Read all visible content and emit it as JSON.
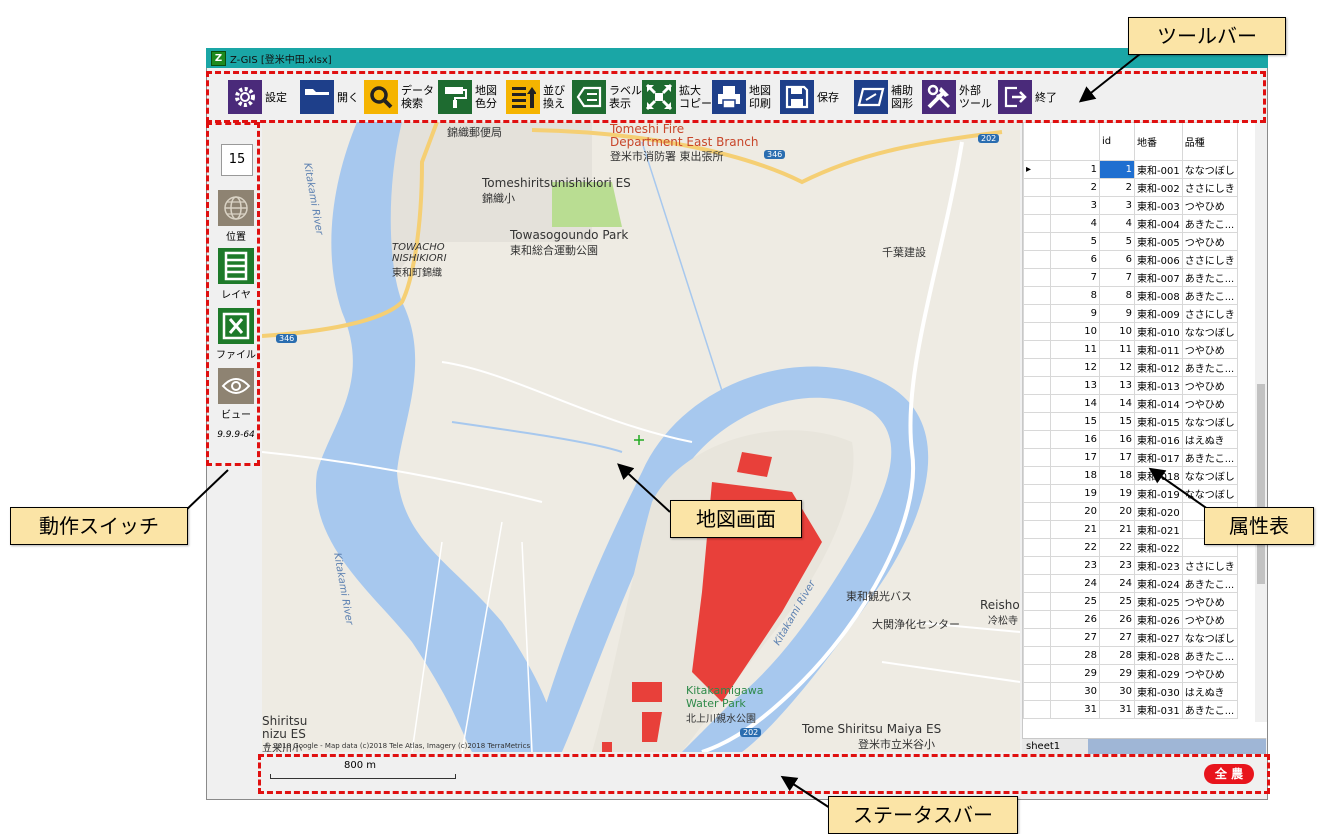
{
  "window": {
    "title": "Z-GIS [登米中田.xlsx]",
    "logo": "Z"
  },
  "toolbar": {
    "items": [
      {
        "label": "設定",
        "icon": "gear-icon",
        "bg": "#4a2a7a"
      },
      {
        "label": "開く",
        "icon": "folder-icon",
        "bg": "#1e3f8a"
      },
      {
        "label": "データ\n検索",
        "icon": "search-icon",
        "bg": "#f5b400"
      },
      {
        "label": "地図\n色分",
        "icon": "paint-roller-icon",
        "bg": "#1e6b30"
      },
      {
        "label": "並び\n換え",
        "icon": "sort-icon",
        "bg": "#f5b400"
      },
      {
        "label": "ラベル\n表示",
        "icon": "label-icon",
        "bg": "#1e6b30"
      },
      {
        "label": "拡大\nコピー",
        "icon": "zoom-copy-icon",
        "bg": "#1e6b30"
      },
      {
        "label": "地図\n印刷",
        "icon": "printer-icon",
        "bg": "#1e3f8a"
      },
      {
        "label": "保存",
        "icon": "save-icon",
        "bg": "#1e3f8a"
      },
      {
        "label": "補助\n図形",
        "icon": "shape-icon",
        "bg": "#1e3f8a"
      },
      {
        "label": "外部\nツール",
        "icon": "tools-icon",
        "bg": "#4a2a7a"
      },
      {
        "label": "終了",
        "icon": "exit-icon",
        "bg": "#4a2a7a"
      }
    ]
  },
  "left_panel": {
    "zoom": "15",
    "switches": [
      {
        "label": "位置",
        "icon": "globe-icon"
      },
      {
        "label": "レイヤ",
        "icon": "layers-icon"
      },
      {
        "label": "ファイル",
        "icon": "excel-file-icon"
      },
      {
        "label": "ビュー",
        "icon": "eye-icon"
      }
    ],
    "version": "9.9.9-64"
  },
  "map": {
    "labels": {
      "post_office": "錦織郵便局",
      "fire_en1": "Tomeshi Fire",
      "fire_en2": "Department East Branch",
      "fire_jp": "登米市消防署 東出張所",
      "es_en": "Tomeshiritsunishikiori ES",
      "es_jp": "錦織小",
      "park_en": "Towasogoundo Park",
      "park_jp": "東和総合運動公園",
      "towacho1": "TOWACHO",
      "towacho2": "NISHIKIORI",
      "towacho_jp": "東和町錦織",
      "chiba": "千葉建設",
      "river1": "Kitakami River",
      "river2": "Kitakami River",
      "river3": "Kitakami River",
      "bus": "東和観光バス",
      "reisho1": "Reisho",
      "reisho2": "冷松寺",
      "jouka": "大関浄化センター",
      "waterpark1": "Kitakamigawa",
      "waterpark2": "Water Park",
      "waterpark_jp": "北上川親水公園",
      "maiya_en": "Tome Shiritsu Maiya ES",
      "maiya_jp": "登米市立米谷小",
      "shiritsu1": "Shiritsu",
      "shiritsu2": "nizu ES",
      "shiritsu3": "立米川小",
      "road346a": "346",
      "road346b": "346",
      "road202a": "202",
      "road202b": "202",
      "copyright": "© 2018 Google - Map data (c)2018 Tele Atlas, Imagery (c)2018 TerraMetrics"
    }
  },
  "attribute_table": {
    "columns": [
      "id",
      "地番",
      "品種"
    ],
    "rows": [
      [
        "1",
        "1",
        "東和-001",
        "ななつぼし"
      ],
      [
        "2",
        "2",
        "東和-002",
        "ささにしき"
      ],
      [
        "3",
        "3",
        "東和-003",
        "つやひめ"
      ],
      [
        "4",
        "4",
        "東和-004",
        "あきたこ..."
      ],
      [
        "5",
        "5",
        "東和-005",
        "つやひめ"
      ],
      [
        "6",
        "6",
        "東和-006",
        "ささにしき"
      ],
      [
        "7",
        "7",
        "東和-007",
        "あきたこ..."
      ],
      [
        "8",
        "8",
        "東和-008",
        "あきたこ..."
      ],
      [
        "9",
        "9",
        "東和-009",
        "ささにしき"
      ],
      [
        "10",
        "10",
        "東和-010",
        "ななつぼし"
      ],
      [
        "11",
        "11",
        "東和-011",
        "つやひめ"
      ],
      [
        "12",
        "12",
        "東和-012",
        "あきたこ..."
      ],
      [
        "13",
        "13",
        "東和-013",
        "つやひめ"
      ],
      [
        "14",
        "14",
        "東和-014",
        "つやひめ"
      ],
      [
        "15",
        "15",
        "東和-015",
        "ななつぼし"
      ],
      [
        "16",
        "16",
        "東和-016",
        "はえぬき"
      ],
      [
        "17",
        "17",
        "東和-017",
        "あきたこ..."
      ],
      [
        "18",
        "18",
        "東和-018",
        "ななつぼし"
      ],
      [
        "19",
        "19",
        "東和-019",
        "ななつぼし"
      ],
      [
        "20",
        "20",
        "東和-020",
        ""
      ],
      [
        "21",
        "21",
        "東和-021",
        ""
      ],
      [
        "22",
        "22",
        "東和-022",
        ""
      ],
      [
        "23",
        "23",
        "東和-023",
        "ささにしき"
      ],
      [
        "24",
        "24",
        "東和-024",
        "あきたこ..."
      ],
      [
        "25",
        "25",
        "東和-025",
        "つやひめ"
      ],
      [
        "26",
        "26",
        "東和-026",
        "つやひめ"
      ],
      [
        "27",
        "27",
        "東和-027",
        "ななつぼし"
      ],
      [
        "28",
        "28",
        "東和-028",
        "あきたこ..."
      ],
      [
        "29",
        "29",
        "東和-029",
        "つやひめ"
      ],
      [
        "30",
        "30",
        "東和-030",
        "はえぬき"
      ],
      [
        "31",
        "31",
        "東和-031",
        "あきたこ..."
      ]
    ],
    "sheet_tab": "sheet1"
  },
  "status_bar": {
    "scale": "800 m",
    "badge": "全 農"
  },
  "callouts": {
    "toolbar": "ツールバー",
    "switch": "動作スイッチ",
    "map": "地図画面",
    "table": "属性表",
    "status": "ステータスバー"
  },
  "colors": {
    "titlebar": "#1aa6a6",
    "annotation_red": "#e01010",
    "callout_bg": "#fbe4a6",
    "field_red": "#e8403a",
    "water": "#a7c8ee"
  }
}
